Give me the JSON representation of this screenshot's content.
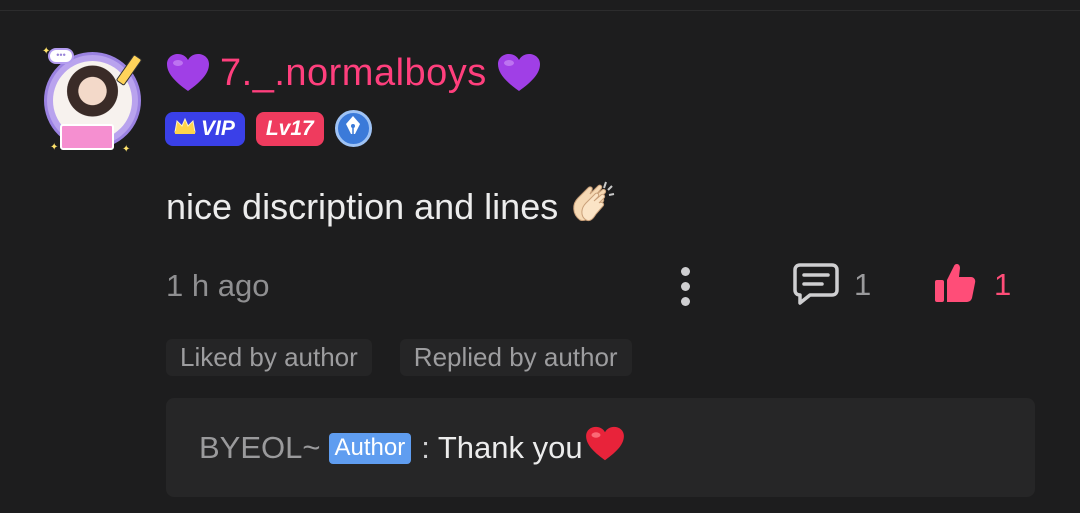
{
  "comment": {
    "username": "7._.normalboys",
    "username_color": "#ff3f7d",
    "heart_color": "#9b3fe0",
    "badges": {
      "vip_label": "VIP",
      "level_label": "Lv17",
      "vip_color": "#3a40e8",
      "level_color": "#ef3b5e",
      "writer_badge_icon": "pen-nib-icon"
    },
    "text": "nice discription and lines",
    "emoji": "clapping-hands-icon",
    "time": "1 h ago",
    "reply_count": "1",
    "like_count": "1",
    "like_color": "#ff4d78"
  },
  "tags": [
    {
      "label": "Liked by author"
    },
    {
      "label": "Replied by author"
    }
  ],
  "reply": {
    "author": "BYEOL~",
    "author_badge": "Author",
    "separator": ":",
    "text": "Thank you",
    "emoji": "red-heart-icon"
  }
}
